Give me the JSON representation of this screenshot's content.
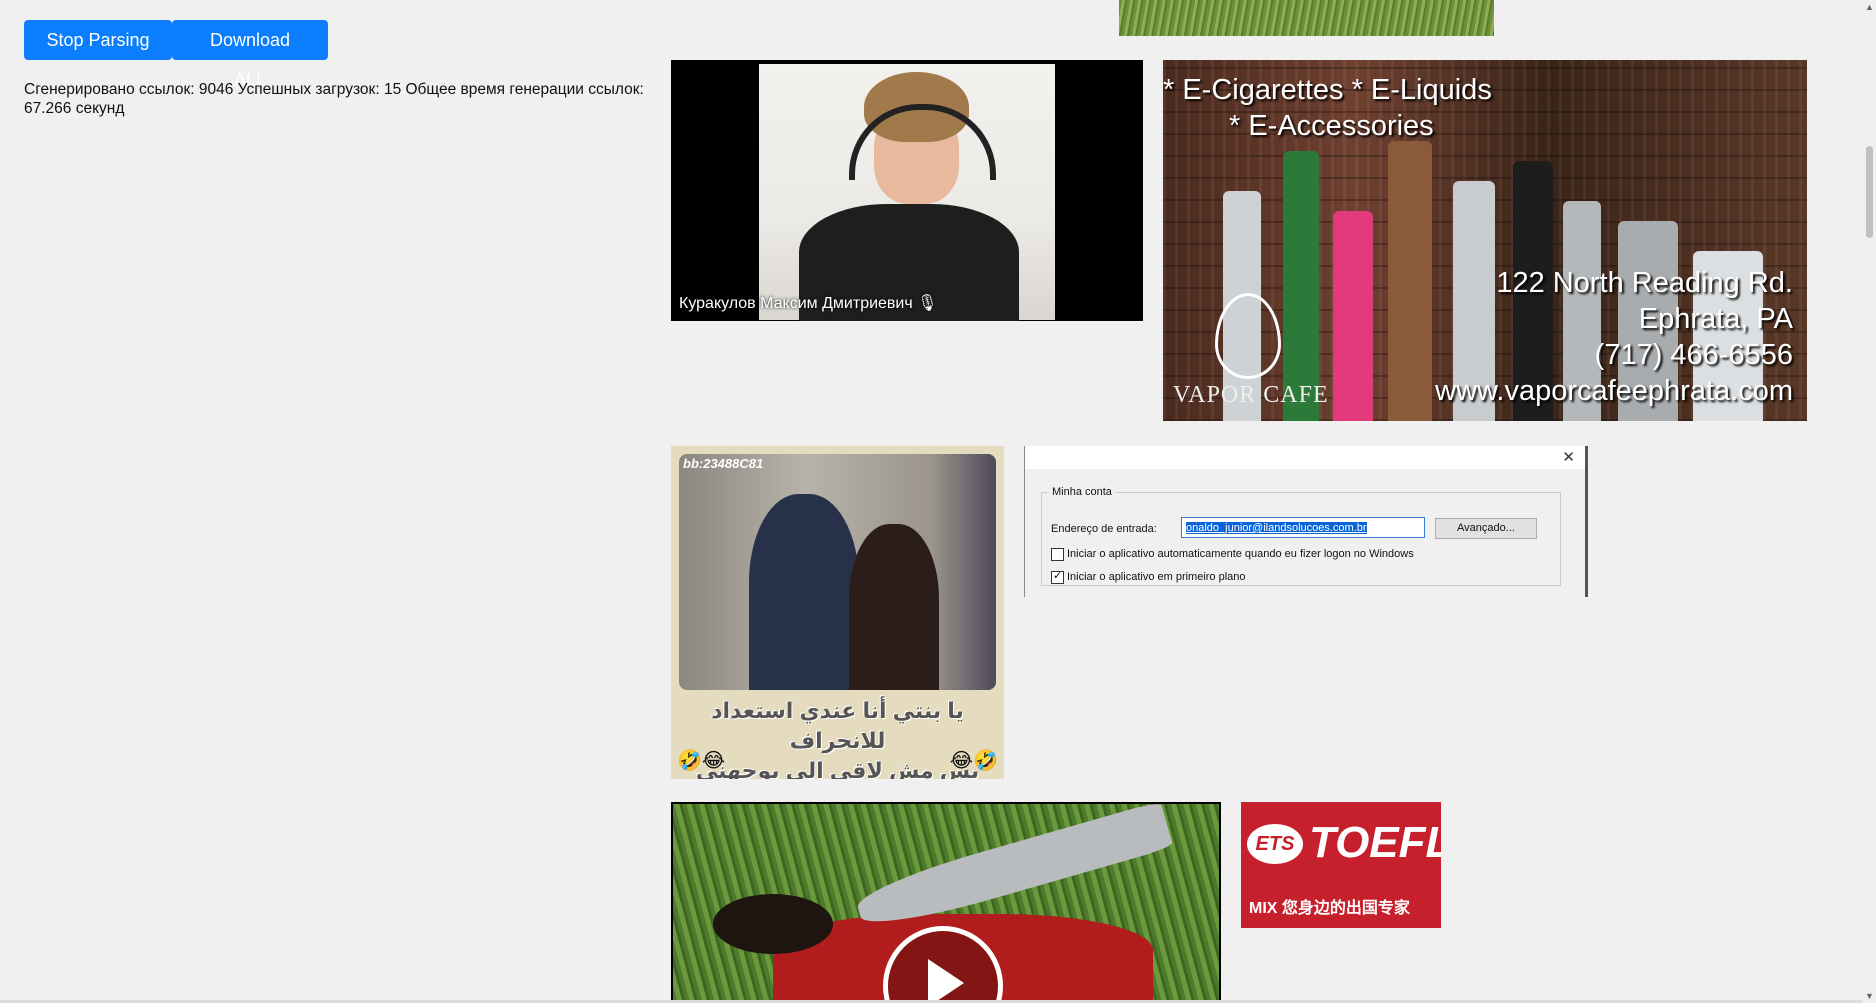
{
  "toolbar": {
    "stop_label": "Stop Parsing",
    "download_label": "Download ALL",
    "accent_color": "#0b7dfd"
  },
  "stats": {
    "text": "Сгенерировано ссылок: 9046 Успешных загрузок: 15 Общее время генерации ссылок: 67.266 секунд"
  },
  "images": {
    "webcam": {
      "caption": "Куракулов Максим Дмитриевич 🎙"
    },
    "vapor": {
      "headline_1": "* E-Cigarettes * E-Liquids",
      "headline_2": "* E-Accessories",
      "address_1": "122 North Reading Rd.",
      "address_2": "Ephrata, PA",
      "phone": "(717) 466-6556",
      "website": "www.vaporcafeephrata.com",
      "brand": "VAPOR CAFE"
    },
    "meme": {
      "tag": "bb:23488C81",
      "line_1": "يا بنتي أنا عندي استعداد للانحراف",
      "line_2": "بس مش لاقي الي يوجهني",
      "emoji_left": "🤣😂",
      "emoji_right": "😂🤣"
    },
    "dialog": {
      "close_glyph": "✕",
      "group_label": "Minha conta",
      "field_label": "Endereço de entrada:",
      "email_value": "onaldo_junior@ilandsolucoes.com.br",
      "advanced_label": "Avançado...",
      "checkbox_1_label": "Iniciar o aplicativo automaticamente quando eu fizer logon no Windows",
      "checkbox_1_checked": false,
      "checkbox_2_label": "Iniciar o aplicativo em primeiro plano",
      "checkbox_2_checked": true
    },
    "toefl": {
      "ets": "ETS",
      "title": "TOEFL",
      "subtitle": "MIX 您身边的出国专家"
    }
  },
  "scrollbar": {
    "up_glyph": "▲",
    "down_glyph": "▼"
  }
}
